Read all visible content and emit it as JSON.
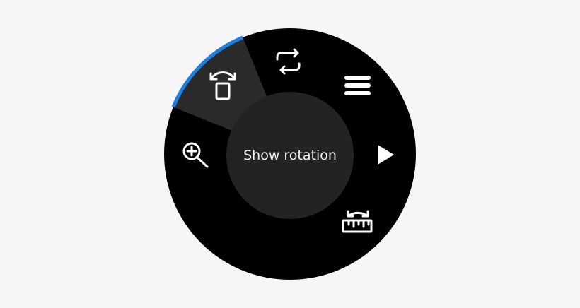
{
  "rotary_menu": {
    "center_label": "Show rotation",
    "selected_item": "rotate-device",
    "accent_color": "#1f7fe0",
    "items": [
      {
        "name": "zoom-in",
        "icon": "zoom-in-icon"
      },
      {
        "name": "rotate-device",
        "icon": "rotate-phone-icon"
      },
      {
        "name": "repeat",
        "icon": "repeat-arrows-icon"
      },
      {
        "name": "menu",
        "icon": "menu-lines-icon"
      },
      {
        "name": "play",
        "icon": "play-icon"
      },
      {
        "name": "rotation-ruler",
        "icon": "ruler-rotate-icon"
      }
    ]
  }
}
